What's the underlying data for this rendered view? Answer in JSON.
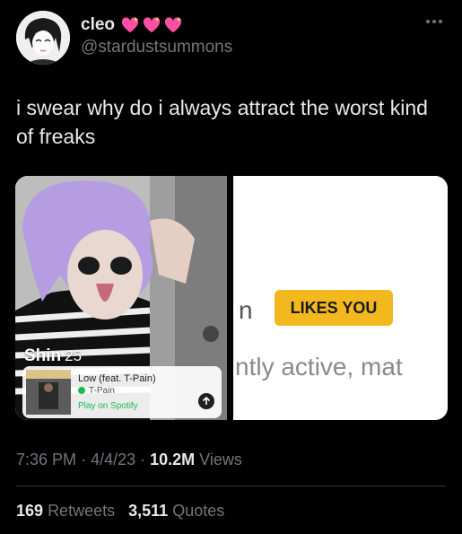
{
  "author": {
    "display_name": "cleo",
    "handle": "@stardustsummons",
    "emoji_icons": [
      "sparkling-heart-icon",
      "sparkling-heart-icon",
      "sparkling-heart-icon"
    ]
  },
  "tweet": {
    "text": "i swear why do i always attract the worst kind\nof freaks"
  },
  "media": {
    "left": {
      "profile_name": "Shin",
      "age": "25",
      "song_title": "Low (feat. T-Pain)",
      "song_artist": "T-Pain",
      "play_label": "Play on Spotify"
    },
    "right": {
      "partial_char": "n",
      "badge_label": "LIKES YOU",
      "active_text": "ntly active, mat"
    }
  },
  "meta": {
    "time": "7:36 PM",
    "date": "4/4/23",
    "views_count": "10.2M",
    "views_label": "Views"
  },
  "stats": {
    "retweets_count": "169",
    "retweets_label": "Retweets",
    "quotes_count": "3,511",
    "quotes_label": "Quotes"
  },
  "colors": {
    "background": "#000000",
    "primary_text": "#e7e9ea",
    "secondary_text": "#71767b",
    "badge": "#f2b81e",
    "spotify_green": "#1db954",
    "heart": "#ff4fa3"
  }
}
